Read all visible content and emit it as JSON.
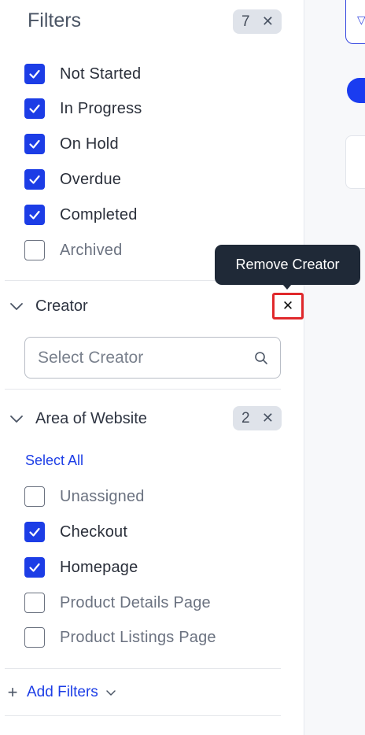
{
  "filters": {
    "title": "Filters",
    "badge_count": "7",
    "badge_clear_icon": "close-icon"
  },
  "status_options": [
    {
      "label": "Not Started",
      "checked": true
    },
    {
      "label": "In Progress",
      "checked": true
    },
    {
      "label": "On Hold",
      "checked": true
    },
    {
      "label": "Overdue",
      "checked": true
    },
    {
      "label": "Completed",
      "checked": true
    },
    {
      "label": "Archived",
      "checked": false
    }
  ],
  "creator": {
    "title": "Creator",
    "tooltip": "Remove Creator",
    "remove_icon": "close-icon",
    "search_placeholder": "Select Creator",
    "search_icon": "search-icon"
  },
  "area": {
    "title": "Area of Website",
    "badge_count": "2",
    "select_all": "Select All",
    "options": [
      {
        "label": "Unassigned",
        "checked": false
      },
      {
        "label": "Checkout",
        "checked": true
      },
      {
        "label": "Homepage",
        "checked": true
      },
      {
        "label": "Product Details Page",
        "checked": false
      },
      {
        "label": "Product Listings Page",
        "checked": false
      }
    ]
  },
  "footer": {
    "add_filters": "Add Filters",
    "plus_icon": "plus-icon",
    "chevron_icon": "chevron-down-icon"
  },
  "colors": {
    "accent": "#1c3de6",
    "highlight_border": "#e0282b",
    "tooltip_bg": "#1f2937",
    "badge_bg": "#dfe3ea"
  }
}
